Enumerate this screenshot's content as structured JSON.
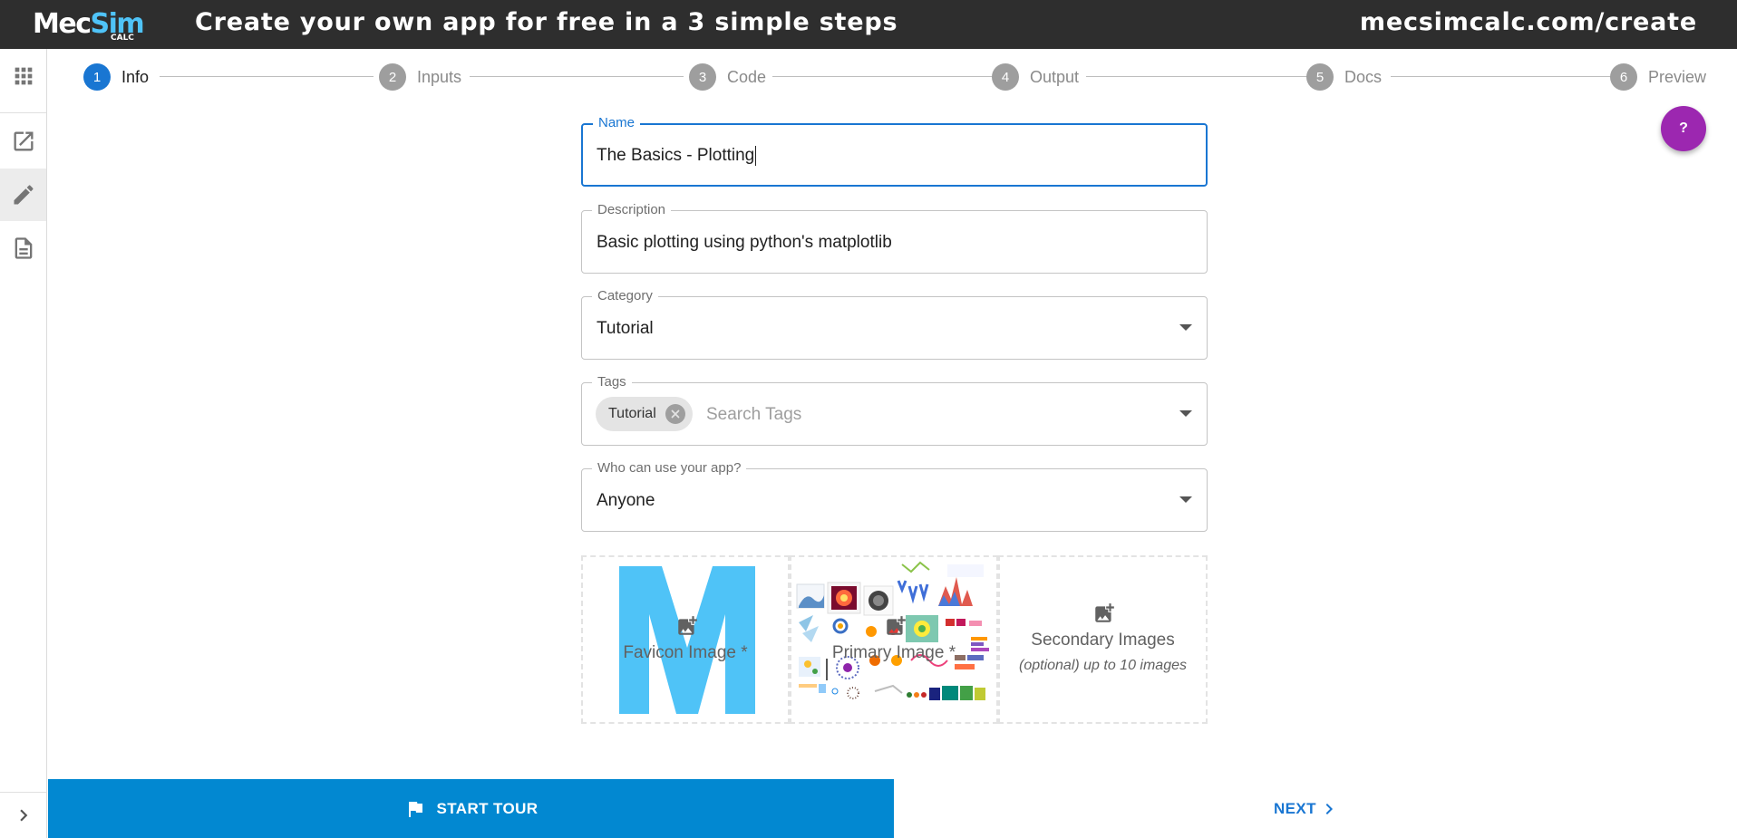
{
  "banner": {
    "logo_main": "Mec",
    "logo_accent": "Sim",
    "logo_sub": "CALC",
    "headline": "Create your own app for free in a 3 simple steps",
    "url": "mecsimcalc.com/create"
  },
  "sidebar": {
    "items": [
      {
        "icon": "apps-grid-icon"
      },
      {
        "icon": "open-in-new-icon"
      },
      {
        "icon": "pencil-icon",
        "active": true
      },
      {
        "icon": "document-icon"
      }
    ],
    "expand_icon": "chevron-right-icon"
  },
  "stepper": {
    "steps": [
      {
        "num": "1",
        "label": "Info",
        "active": true
      },
      {
        "num": "2",
        "label": "Inputs"
      },
      {
        "num": "3",
        "label": "Code"
      },
      {
        "num": "4",
        "label": "Output"
      },
      {
        "num": "5",
        "label": "Docs"
      },
      {
        "num": "6",
        "label": "Preview"
      }
    ]
  },
  "form": {
    "name": {
      "label": "Name",
      "value": "The Basics - Plotting"
    },
    "description": {
      "label": "Description",
      "value": "Basic plotting using python's matplotlib"
    },
    "category": {
      "label": "Category",
      "value": "Tutorial"
    },
    "tags": {
      "label": "Tags",
      "chips": [
        "Tutorial"
      ],
      "placeholder": "Search Tags"
    },
    "access": {
      "label": "Who can use your app?",
      "value": "Anyone"
    }
  },
  "images": {
    "favicon_label": "Favicon Image *",
    "primary_label": "Primary Image *",
    "secondary_label": "Secondary Images",
    "secondary_hint": "(optional) up to 10 images"
  },
  "help": {
    "label": "?"
  },
  "footer": {
    "tour_label": "START TOUR",
    "next_label": "NEXT"
  },
  "colors": {
    "banner_bg": "#2e2e2e",
    "primary": "#1976d2",
    "tour_bg": "#0288d1",
    "help_fab": "#9c27b0",
    "favicon_m": "#4fc3f7"
  }
}
